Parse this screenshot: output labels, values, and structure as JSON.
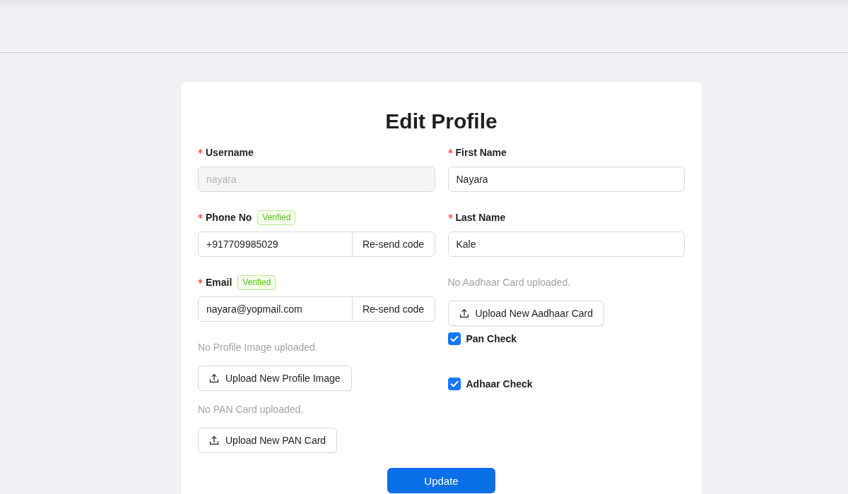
{
  "page": {
    "title": "Edit Profile"
  },
  "form": {
    "left_column": [
      {
        "kind": "field",
        "label": "Username",
        "required": true,
        "value": "nayara",
        "disabled": true
      },
      {
        "kind": "verified_field",
        "label": "Phone No",
        "required": true,
        "badge": "Verified",
        "value": "+917709985029",
        "disabled": false,
        "action": "Re-send code"
      },
      {
        "kind": "verified_field",
        "label": "Email",
        "required": true,
        "badge": "Verified",
        "value": "nayara@yopmail.com",
        "disabled": false,
        "action": "Re-send code"
      },
      {
        "kind": "upload",
        "status": "No Profile Image uploaded.",
        "button": "Upload New Profile Image"
      },
      {
        "kind": "upload",
        "status": "No PAN Card uploaded.",
        "button": "Upload New PAN Card"
      }
    ],
    "right_column": [
      {
        "kind": "field",
        "label": "First Name",
        "required": true,
        "value": "Nayara",
        "disabled": false
      },
      {
        "kind": "field",
        "label": "Last Name",
        "required": true,
        "value": "Kale",
        "disabled": false
      },
      {
        "kind": "upload",
        "status": "No Aadhaar Card uploaded.",
        "button": "Upload New Aadhaar Card"
      },
      {
        "kind": "checkbox",
        "label": "Pan Check",
        "checked": true
      },
      {
        "kind": "checkbox",
        "label": "Adhaar Check",
        "checked": true
      }
    ]
  },
  "submit_button": {
    "label": "Update"
  }
}
